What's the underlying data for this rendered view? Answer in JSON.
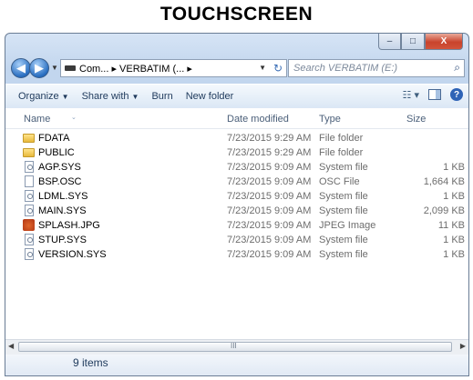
{
  "caption": "TOUCHSCREEN",
  "window": {
    "controls": {
      "minimize": "‒",
      "maximize": "□",
      "close": "X"
    }
  },
  "address": {
    "path": "Com... ▸ VERBATIM (... ▸",
    "search_placeholder": "Search VERBATIM (E:)"
  },
  "toolbar": {
    "organize": "Organize",
    "share_with": "Share with",
    "burn": "Burn",
    "new_folder": "New folder"
  },
  "columns": {
    "name": "Name",
    "date": "Date modified",
    "type": "Type",
    "size": "Size"
  },
  "files": [
    {
      "name": "FDATA",
      "date": "7/23/2015 9:29 AM",
      "type": "File folder",
      "size": "",
      "icon": "folder"
    },
    {
      "name": "PUBLIC",
      "date": "7/23/2015 9:29 AM",
      "type": "File folder",
      "size": "",
      "icon": "folder"
    },
    {
      "name": "AGP.SYS",
      "date": "7/23/2015 9:09 AM",
      "type": "System file",
      "size": "1 KB",
      "icon": "sys"
    },
    {
      "name": "BSP.OSC",
      "date": "7/23/2015 9:09 AM",
      "type": "OSC File",
      "size": "1,664 KB",
      "icon": "file"
    },
    {
      "name": "LDML.SYS",
      "date": "7/23/2015 9:09 AM",
      "type": "System file",
      "size": "1 KB",
      "icon": "sys"
    },
    {
      "name": "MAIN.SYS",
      "date": "7/23/2015 9:09 AM",
      "type": "System file",
      "size": "2,099 KB",
      "icon": "sys"
    },
    {
      "name": "SPLASH.JPG",
      "date": "7/23/2015 9:09 AM",
      "type": "JPEG Image",
      "size": "11 KB",
      "icon": "image"
    },
    {
      "name": "STUP.SYS",
      "date": "7/23/2015 9:09 AM",
      "type": "System file",
      "size": "1 KB",
      "icon": "sys"
    },
    {
      "name": "VERSION.SYS",
      "date": "7/23/2015 9:09 AM",
      "type": "System file",
      "size": "1 KB",
      "icon": "sys"
    }
  ],
  "status": {
    "item_count": "9 items"
  }
}
